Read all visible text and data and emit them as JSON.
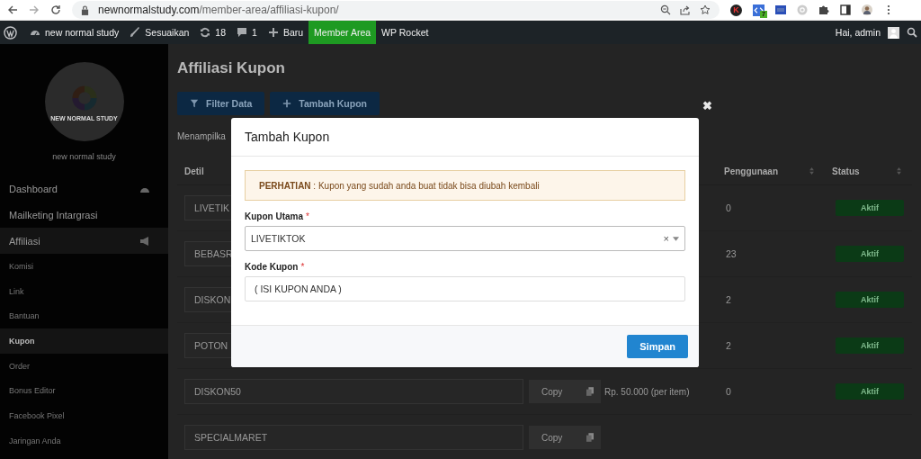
{
  "browser": {
    "url_host": "newnormalstudy.com",
    "url_path": "/member-area/affiliasi-kupon/",
    "extension_badge": "7",
    "extension_letter": "K"
  },
  "admin_bar": {
    "items": [
      {
        "kind": "site",
        "label": "new normal study",
        "selected": false
      },
      {
        "kind": "customize",
        "label": "Sesuaikan",
        "selected": false
      },
      {
        "kind": "updates",
        "label": "18",
        "selected": false
      },
      {
        "kind": "comments",
        "label": "1",
        "selected": false
      },
      {
        "kind": "new",
        "label": "Baru",
        "selected": false
      },
      {
        "kind": "plain",
        "label": "Member Area",
        "selected": true
      },
      {
        "kind": "plain",
        "label": "WP Rocket",
        "selected": false
      }
    ],
    "greeting": "Hai, admin"
  },
  "sidebar": {
    "logo_text": "NEW NORMAL STUDY",
    "site_name": "new normal study",
    "items": [
      {
        "label": "Dashboard",
        "selected": false
      },
      {
        "label": "Mailketing Intargrasi",
        "selected": false
      },
      {
        "label": "Affiliasi",
        "selected": true,
        "children": [
          {
            "label": "Komisi",
            "selected": false
          },
          {
            "label": "Link",
            "selected": false
          },
          {
            "label": "Bantuan",
            "selected": false
          },
          {
            "label": "Kupon",
            "selected": true
          },
          {
            "label": "Order",
            "selected": false
          },
          {
            "label": "Bonus Editor",
            "selected": false
          },
          {
            "label": "Facebook Pixel",
            "selected": false
          },
          {
            "label": "Jaringan Anda",
            "selected": false
          }
        ]
      }
    ]
  },
  "page": {
    "title": "Affiliasi Kupon",
    "buttons": [
      {
        "kind": "filter",
        "label": "Filter Data"
      },
      {
        "kind": "add",
        "label": "Tambah Kupon"
      }
    ],
    "info": "Menampilka"
  },
  "table": {
    "columns": [
      {
        "label": "Detil",
        "sortable": false
      },
      {
        "label": "Penggunaan",
        "sortable": true
      },
      {
        "label": "Status",
        "sortable": true
      }
    ],
    "rows": [
      {
        "detail": "LIVETIK",
        "usage": "0",
        "status": "Aktif"
      },
      {
        "detail": "BEBASR",
        "usage": "23",
        "status": "Aktif"
      },
      {
        "detail": "DISKON",
        "usage": "2",
        "status": "Aktif"
      },
      {
        "detail": "POTON",
        "usage": "2",
        "status": "Aktif"
      },
      {
        "detail": "DISKON50",
        "copy": "Copy",
        "price": "Rp. 50.000 (per item)",
        "usage": "0",
        "status": "Aktif"
      },
      {
        "detail": "SPECIALMARET",
        "copy": "Copy"
      }
    ]
  },
  "modal": {
    "title": "Tambah Kupon",
    "close": "✖",
    "alert": "**PERHATIAN** : Kupon yang sudah anda buat tidak bisa diubah kembali",
    "fields": [
      {
        "kind": "select",
        "label": "Kupon Utama",
        "required_mark": "*",
        "value": "LIVETIKTOK",
        "clear": "×"
      },
      {
        "kind": "text",
        "label": "Kode Kupon",
        "required_mark": "*",
        "value": "( ISI KUPON ANDA )"
      }
    ],
    "submit": "Simpan"
  }
}
